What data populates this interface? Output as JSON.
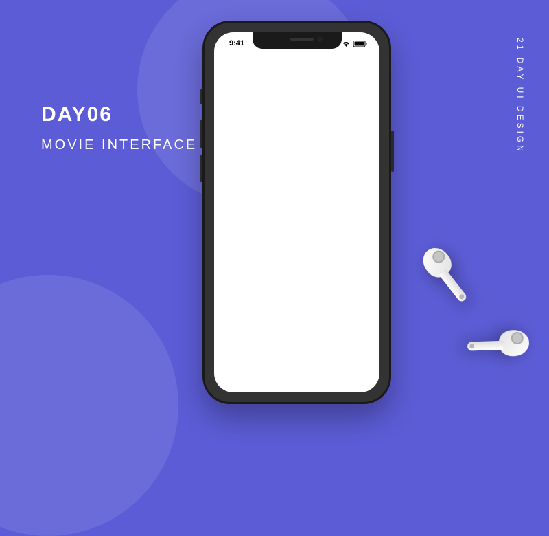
{
  "title": "DAY06",
  "subtitle": "MOVIE INTERFACE",
  "side_label": "21 DAY UI DESIGN",
  "phone": {
    "status": {
      "time": "9:41"
    }
  },
  "colors": {
    "background": "#5c5cd6",
    "circle": "#6b6bd9",
    "text": "#ffffff"
  }
}
